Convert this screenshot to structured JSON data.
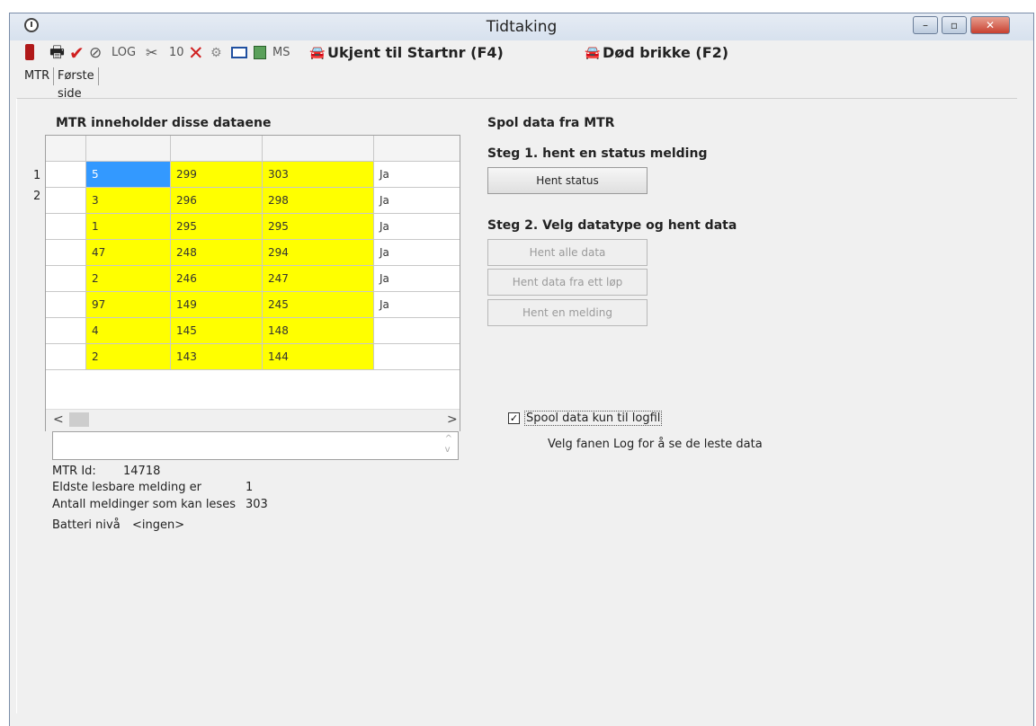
{
  "window": {
    "title": "Tidtaking"
  },
  "title_buttons": [
    "–",
    "▫",
    "✕"
  ],
  "toolbar": {
    "log": "LOG",
    "ten": "10",
    "ms": "MS",
    "unknown_start": "Ukjent til Startnr (F4)",
    "dead_chip": "Død brikke (F2)"
  },
  "tabs": [
    {
      "label": "MTR"
    },
    {
      "label": "Første side"
    }
  ],
  "left": {
    "heading": "MTR inneholder disse dataene",
    "row_labels": [
      "1",
      "2"
    ],
    "grid_rows": [
      [
        "5",
        "299",
        "303",
        "Ja"
      ],
      [
        "3",
        "296",
        "298",
        "Ja"
      ],
      [
        "1",
        "295",
        "295",
        "Ja"
      ],
      [
        "47",
        "248",
        "294",
        "Ja"
      ],
      [
        "2",
        "246",
        "247",
        "Ja"
      ],
      [
        "97",
        "149",
        "245",
        "Ja"
      ],
      [
        "4",
        "145",
        "148",
        ""
      ],
      [
        "2",
        "143",
        "144",
        ""
      ]
    ],
    "mtr_id_label": "MTR Id:",
    "mtr_id_value": "14718",
    "oldest_label": "Eldste lesbare melding er",
    "oldest_value": "1",
    "count_label": "Antall meldinger som kan leses",
    "count_value": "303",
    "battery_label": "Batteri nivå",
    "battery_value": "<ingen>"
  },
  "right": {
    "heading": "Spol data fra MTR",
    "step1": "Steg 1. hent en status melding",
    "btn_status": "Hent status",
    "step2": "Steg 2. Velg datatype og hent data",
    "btn_all": "Hent alle data",
    "btn_one_race": "Hent data fra ett løp",
    "btn_one_msg": "Hent en melding",
    "spool_checkbox": "Spool data kun til logfil",
    "spool_checked": true,
    "hint": "Velg fanen Log for å se de leste data"
  },
  "colors": {
    "highlight": "#ffff00",
    "selected": "#3399ff",
    "check_red": "#d02020"
  }
}
